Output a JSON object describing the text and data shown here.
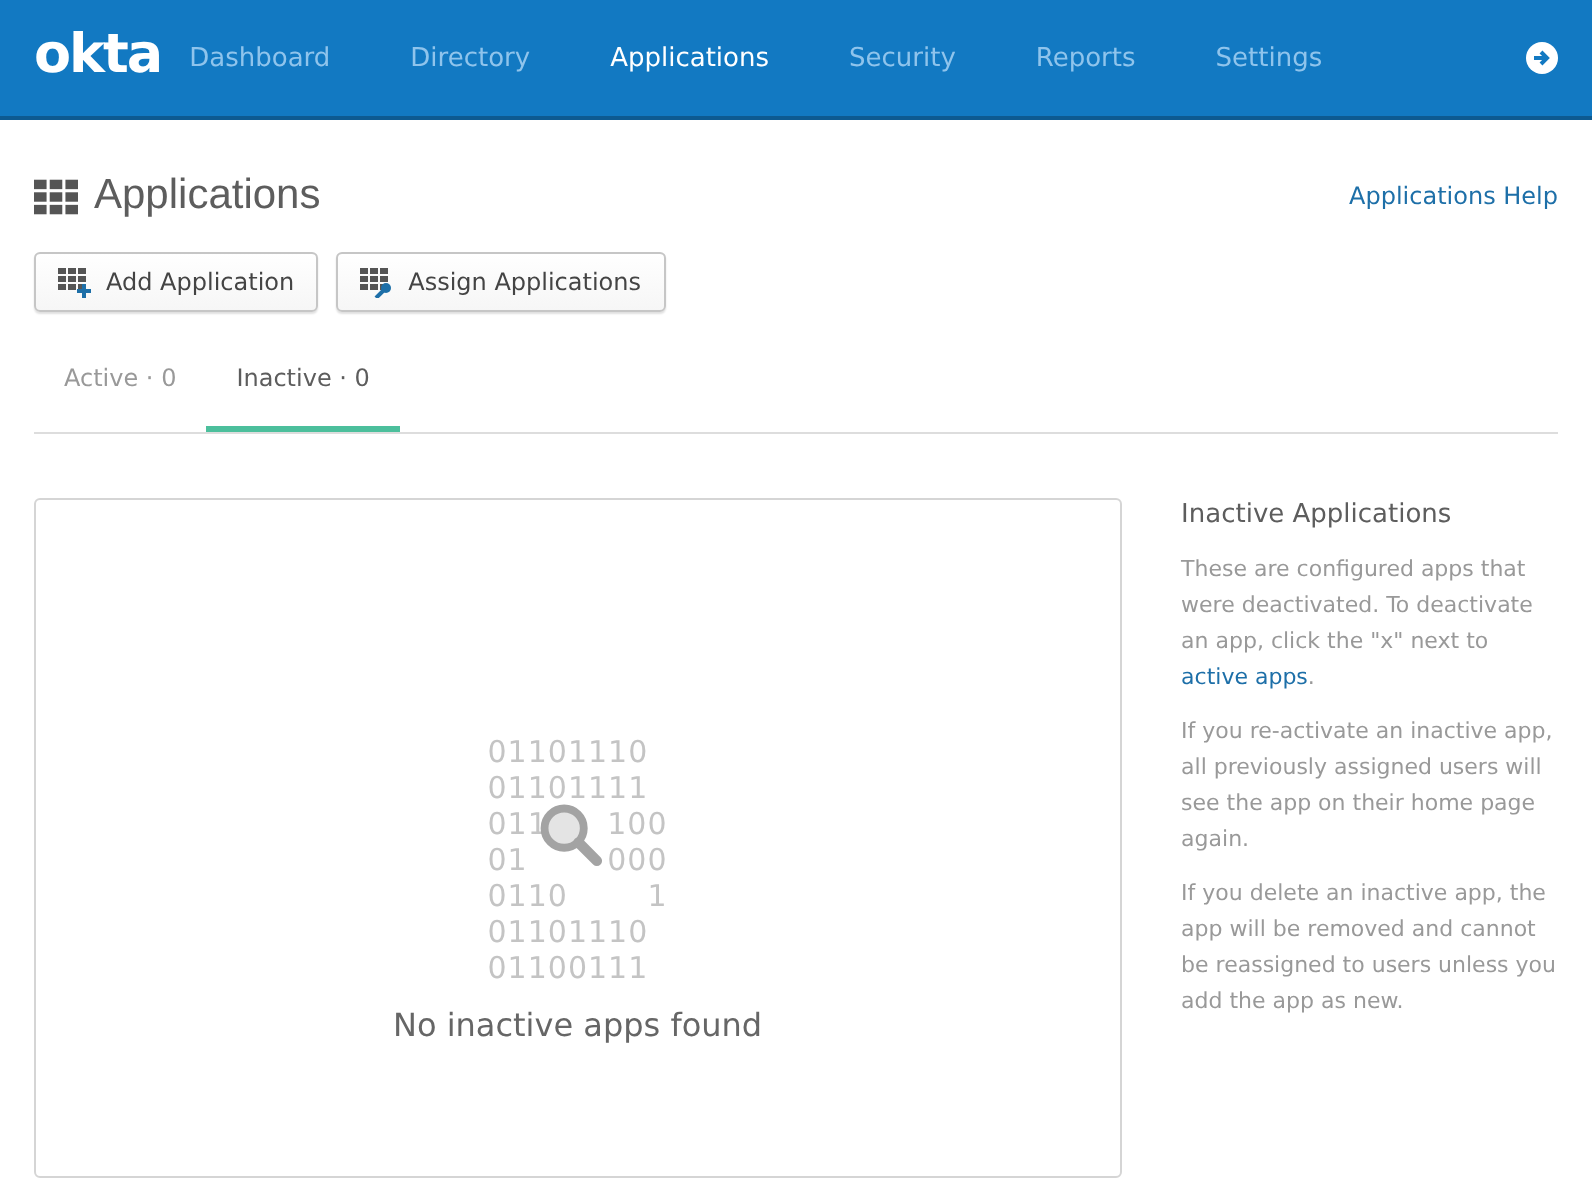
{
  "header": {
    "logo": "okta",
    "nav": [
      {
        "label": "Dashboard",
        "selected": false
      },
      {
        "label": "Directory",
        "selected": false
      },
      {
        "label": "Applications",
        "selected": true
      },
      {
        "label": "Security",
        "selected": false
      },
      {
        "label": "Reports",
        "selected": false
      },
      {
        "label": "Settings",
        "selected": false
      }
    ]
  },
  "page": {
    "title": "Applications",
    "help_link": "Applications Help"
  },
  "buttons": [
    {
      "label": "Add Application",
      "kind": "add"
    },
    {
      "label": "Assign Applications",
      "kind": "assign"
    }
  ],
  "tabs": [
    {
      "label": "Active · 0",
      "selected": false
    },
    {
      "label": "Inactive · 0",
      "selected": true
    }
  ],
  "empty_state": {
    "binary": [
      [
        "01101110"
      ],
      [
        "01101111"
      ],
      [
        "011",
        "100"
      ],
      [
        "01",
        "000"
      ],
      [
        "0110",
        "1"
      ],
      [
        "01101110"
      ],
      [
        "01100111"
      ]
    ],
    "message": "No inactive apps found"
  },
  "sidebar": {
    "title": "Inactive Applications",
    "paragraphs": [
      {
        "text": "These are configured apps that were deactivated. To deactivate an app, click the \"x\" next to",
        "link": "active apps",
        "after": "."
      },
      {
        "text": "If you re-activate an inactive app, all previously assigned users will see the app on their home page again."
      },
      {
        "text": "If you delete an inactive app, the app will be removed and cannot be reassigned to users unless you add the app as new."
      }
    ]
  }
}
